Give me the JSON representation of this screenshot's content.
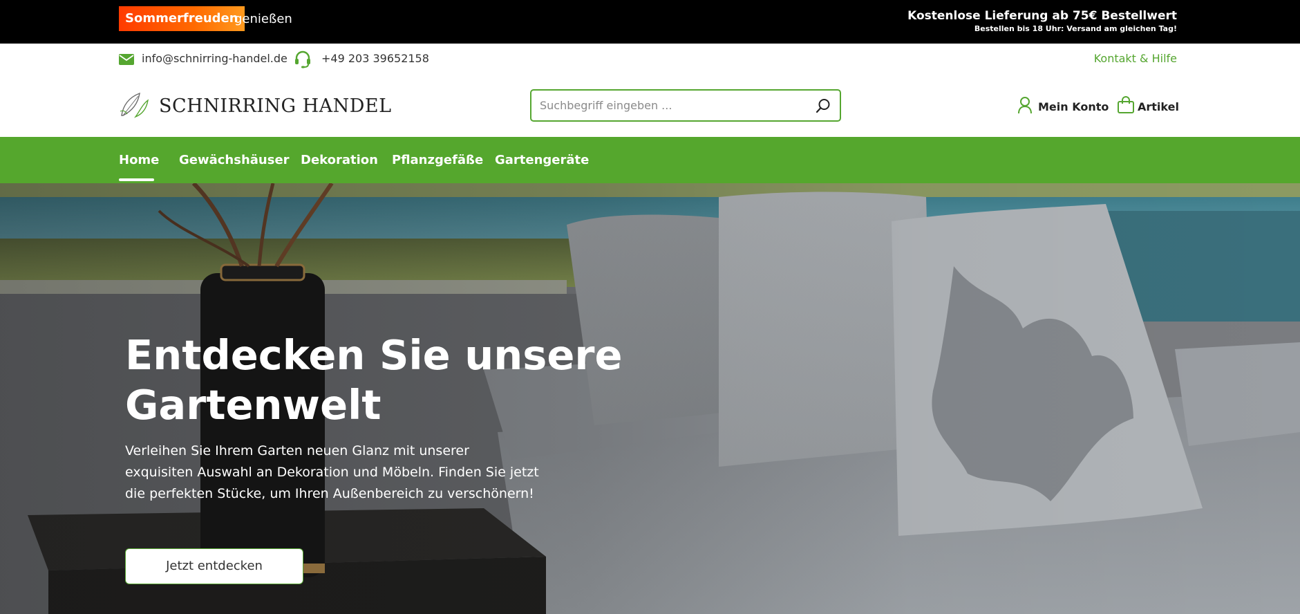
{
  "promo": {
    "badge": "Sommerfreuden",
    "text": "genießen",
    "shipping_title": "Kostenlose Lieferung ab 75€ Bestellwert",
    "shipping_sub": "Bestellen bis 18 Uhr: Versand am gleichen Tag!"
  },
  "contact": {
    "email": "info@schnirring-handel.de",
    "phone": "+49 203 39652158",
    "help_link": "Kontakt & Hilfe"
  },
  "header": {
    "logo_text": "SCHNIRRING HANDEL",
    "search_placeholder": "Suchbegriff eingeben ...",
    "account_label": "Mein Konto",
    "cart_label": "Artikel"
  },
  "nav": {
    "items": [
      {
        "label": "Home",
        "active": true
      },
      {
        "label": "Gewächshäuser",
        "active": false
      },
      {
        "label": "Dekoration",
        "active": false
      },
      {
        "label": "Pflanzgefäße",
        "active": false
      },
      {
        "label": "Gartengeräte",
        "active": false
      }
    ]
  },
  "hero": {
    "title": "Entdecken Sie unsere Gartenwelt",
    "text": "Verleihen Sie Ihrem Garten neuen Glanz mit unserer exquisiten Auswahl an Dekoration und Möbeln. Finden Sie jetzt die perfekten Stücke, um Ihren Außenbereich zu verschönern!",
    "cta": "Jetzt entdecken"
  },
  "colors": {
    "brand_green": "#55a630",
    "promo_orange": "#ff5a00",
    "topbar": "#000000"
  },
  "icons": [
    "mail-icon",
    "headset-icon",
    "logo-leaf-icon",
    "search-icon",
    "user-icon",
    "shopping-bag-icon"
  ]
}
